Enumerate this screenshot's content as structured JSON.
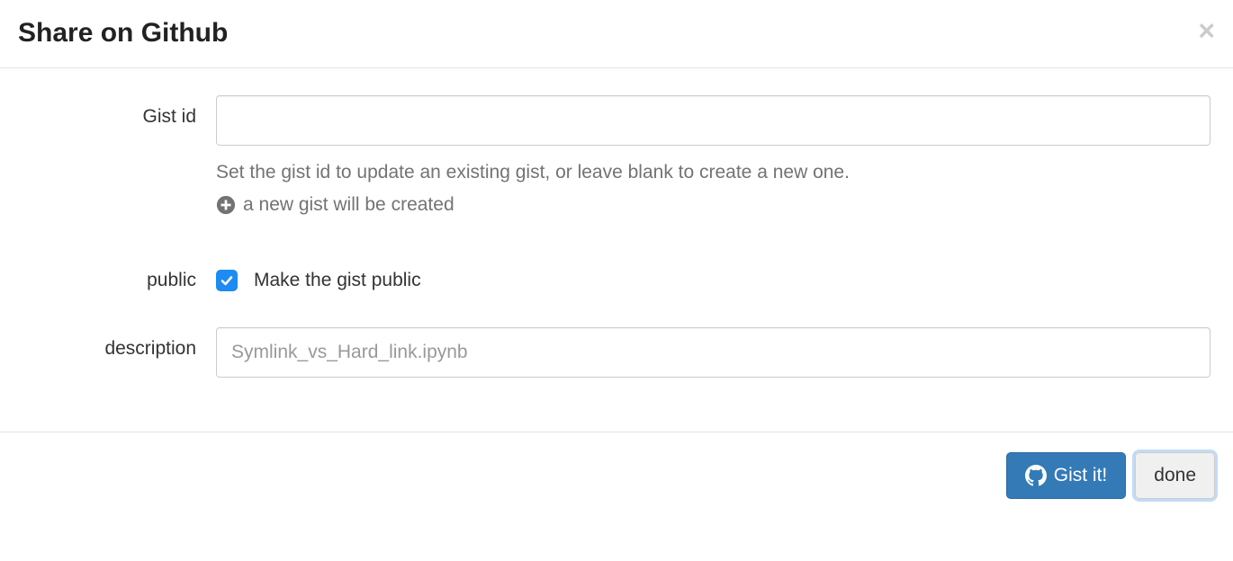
{
  "header": {
    "title": "Share on Github"
  },
  "form": {
    "gist_id": {
      "label": "Gist id",
      "value": "",
      "help_line1": "Set the gist id to update an existing gist, or leave blank to create a new one.",
      "help_line2": "a new gist will be created"
    },
    "public": {
      "label": "public",
      "checkbox_label": "Make the gist public",
      "checked": true
    },
    "description": {
      "label": "description",
      "value": "",
      "placeholder": "Symlink_vs_Hard_link.ipynb"
    }
  },
  "footer": {
    "gist_button": "Gist it!",
    "done_button": "done"
  }
}
